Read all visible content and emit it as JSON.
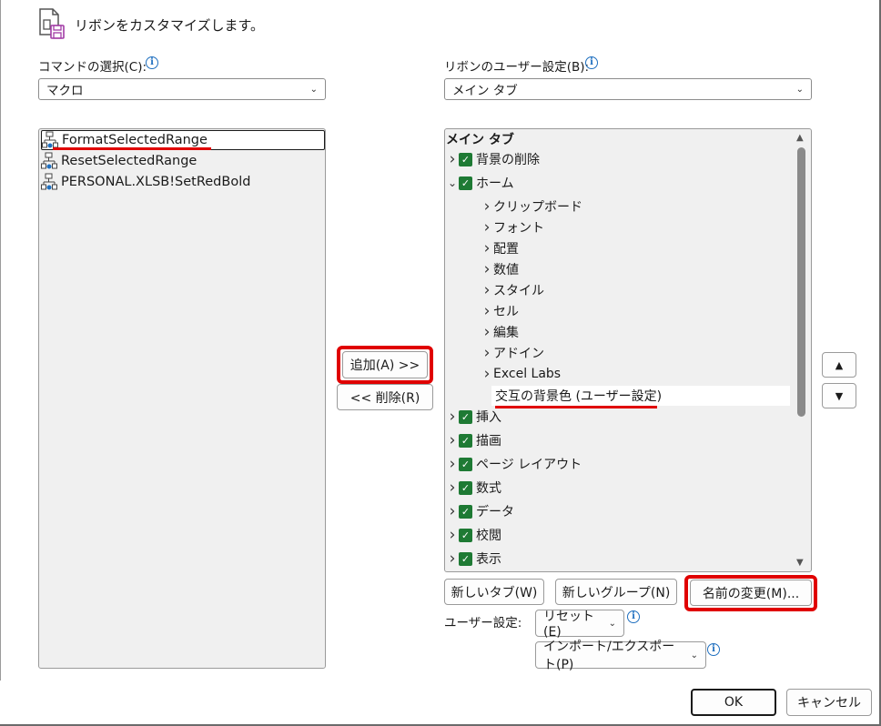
{
  "header": {
    "title": "リボンをカスタマイズします。",
    "icon": "customize-ribbon-icon"
  },
  "left": {
    "label": "コマンドの選択(C):",
    "combo_value": "マクロ",
    "commands": [
      {
        "label": "FormatSelectedRange",
        "selected": true
      },
      {
        "label": "ResetSelectedRange",
        "selected": false
      },
      {
        "label": "PERSONAL.XLSB!SetRedBold",
        "selected": false
      }
    ]
  },
  "middle": {
    "add_label": "追加(A) >>",
    "remove_label": "<< 削除(R)"
  },
  "right": {
    "label": "リボンのユーザー設定(B):",
    "combo_value": "メイン タブ",
    "tree_header": "メイン タブ",
    "tree": [
      {
        "label": "背景の削除",
        "level": 0,
        "checked": true,
        "expanded": false
      },
      {
        "label": "ホーム",
        "level": 0,
        "checked": true,
        "expanded": true
      },
      {
        "label": "クリップボード",
        "level": 1
      },
      {
        "label": "フォント",
        "level": 1
      },
      {
        "label": "配置",
        "level": 1
      },
      {
        "label": "数値",
        "level": 1
      },
      {
        "label": "スタイル",
        "level": 1
      },
      {
        "label": "セル",
        "level": 1
      },
      {
        "label": "編集",
        "level": 1
      },
      {
        "label": "アドイン",
        "level": 1
      },
      {
        "label": "Excel Labs",
        "level": 1
      },
      {
        "label": "交互の背景色 (ユーザー設定)",
        "level": 2,
        "highlighted": true
      },
      {
        "label": "挿入",
        "level": 0,
        "checked": true,
        "expanded": false
      },
      {
        "label": "描画",
        "level": 0,
        "checked": true,
        "expanded": false
      },
      {
        "label": "ページ レイアウト",
        "level": 0,
        "checked": true,
        "expanded": false
      },
      {
        "label": "数式",
        "level": 0,
        "checked": true,
        "expanded": false
      },
      {
        "label": "データ",
        "level": 0,
        "checked": true,
        "expanded": false
      },
      {
        "label": "校閲",
        "level": 0,
        "checked": true,
        "expanded": false
      },
      {
        "label": "表示",
        "level": 0,
        "checked": true,
        "expanded": false
      }
    ],
    "new_tab_label": "新しいタブ(W)",
    "new_group_label": "新しいグループ(N)",
    "rename_label": "名前の変更(M)...",
    "user_settings_label": "ユーザー設定:",
    "reset_label": "リセット(E)",
    "import_export_label": "インポート/エクスポート(P)"
  },
  "footer": {
    "ok_label": "OK",
    "cancel_label": "キャンセル"
  },
  "colors": {
    "highlight_red": "#e00000",
    "check_green": "#1e7a34",
    "info_blue": "#1f6fbf"
  }
}
